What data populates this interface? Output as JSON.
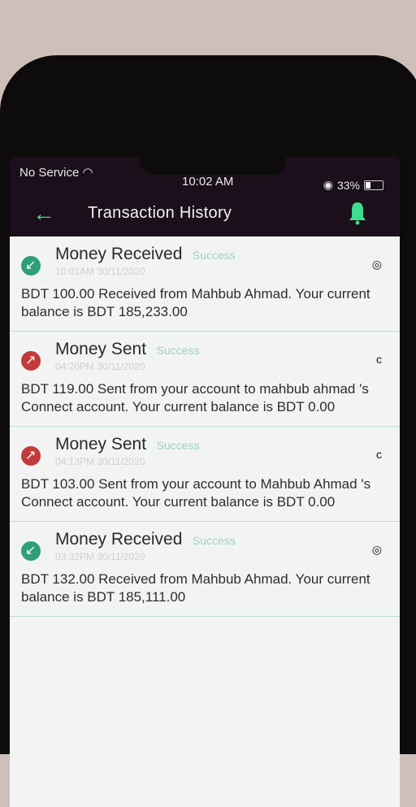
{
  "status_bar": {
    "carrier": "No Service",
    "time": "10:02 AM",
    "battery": "33%",
    "battery_level": 0.33
  },
  "header": {
    "title": "Transaction History"
  },
  "transactions": [
    {
      "type": "Money Received",
      "status": "Success",
      "date": "10:01AM 30/11/2020",
      "message": "BDT 100.00 Received from Mahbub Ahmad. Your current balance is BDT 185,233.00",
      "direction": "received"
    },
    {
      "type": "Money Sent",
      "status": "Success",
      "date": "04:20PM 30/11/2020",
      "message": "BDT 119.00 Sent from your account to mahbub ahmad 's Connect account. Your current balance is BDT 0.00",
      "direction": "sent"
    },
    {
      "type": "Money Sent",
      "status": "Success",
      "date": "04:13PM 30/11/2020",
      "message": "BDT 103.00 Sent from your account to Mahbub Ahmad 's Connect account. Your current balance is BDT 0.00",
      "direction": "sent"
    },
    {
      "type": "Money Received",
      "status": "Success",
      "date": "03:32PM 30/11/2020",
      "message": "BDT 132.00 Received from Mahbub Ahmad. Your current balance is BDT 185,111.00",
      "direction": "received"
    }
  ]
}
